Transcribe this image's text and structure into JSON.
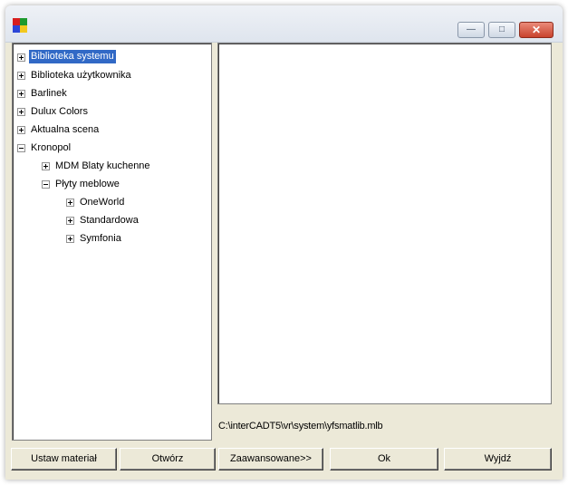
{
  "window": {
    "title": "",
    "icon": "app-icon-colored-squares",
    "controls": {
      "minimize": "minimize-icon",
      "maximize": "maximize-icon",
      "close": "close-icon"
    }
  },
  "tree": {
    "items": [
      {
        "label": "Biblioteka systemu",
        "level": 0,
        "expander": "plus",
        "selected": true
      },
      {
        "label": "Biblioteka użytkownika",
        "level": 0,
        "expander": "plus",
        "selected": false
      },
      {
        "label": "Barlinek",
        "level": 0,
        "expander": "plus",
        "selected": false
      },
      {
        "label": "Dulux Colors",
        "level": 0,
        "expander": "plus",
        "selected": false
      },
      {
        "label": "Aktualna scena",
        "level": 0,
        "expander": "plus",
        "selected": false
      },
      {
        "label": "Kronopol",
        "level": 0,
        "expander": "minus",
        "selected": false
      },
      {
        "label": "MDM Blaty kuchenne",
        "level": 1,
        "expander": "plus",
        "selected": false
      },
      {
        "label": "Płyty meblowe",
        "level": 1,
        "expander": "minus",
        "selected": false
      },
      {
        "label": "OneWorld",
        "level": 2,
        "expander": "plus",
        "selected": false
      },
      {
        "label": "Standardowa",
        "level": 2,
        "expander": "plus",
        "selected": false
      },
      {
        "label": "Symfonia",
        "level": 2,
        "expander": "plus",
        "selected": false
      }
    ]
  },
  "status": {
    "path": "C:\\interCADT5\\vr\\system\\yfsmatlib.mlb"
  },
  "buttons": {
    "set_material": "Ustaw materiał",
    "open": "Otwórz",
    "advanced": "Zaawansowane>>",
    "ok": "Ok",
    "exit": "Wyjdź"
  },
  "colors": {
    "selection": "#3169c6",
    "window_bg": "#ece9d8",
    "close_button": "#c9432d"
  }
}
